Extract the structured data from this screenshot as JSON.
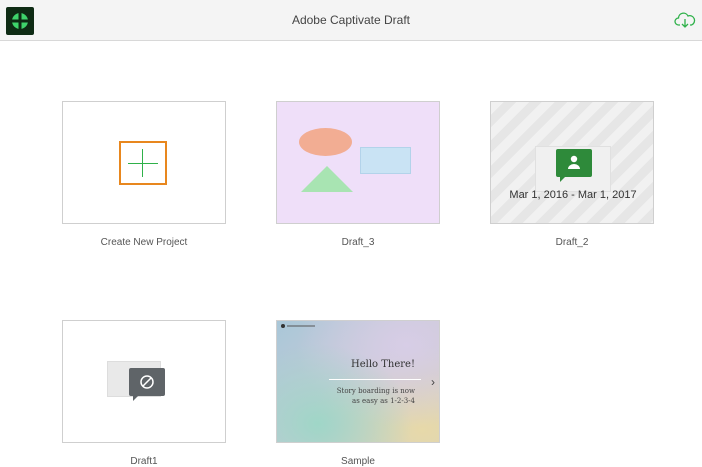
{
  "app": {
    "title": "Adobe Captivate Draft"
  },
  "header": {
    "cloud_icon": "cloud-download-icon",
    "logo_icon": "captivate-logo-icon"
  },
  "tiles": [
    {
      "label": "Create New Project",
      "icon": "plus-icon"
    },
    {
      "label": "Draft_3"
    },
    {
      "label": "Draft_2",
      "date_range": "Mar 1, 2016 - Mar 1, 2017",
      "icon": "person-speech-icon"
    },
    {
      "label": "Draft1",
      "icon": "disabled-speech-icon"
    },
    {
      "label": "Sample",
      "slide_title": "Hello There!",
      "slide_line1": "Story boarding is now",
      "slide_line2": "as easy as 1-2-3-4",
      "icon": "chevron-right-icon"
    }
  ],
  "colors": {
    "accent_orange": "#e8871e",
    "accent_green": "#2fb14a",
    "draft2_icon": "#2e8a3a"
  }
}
